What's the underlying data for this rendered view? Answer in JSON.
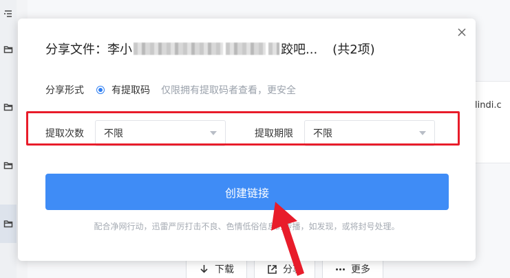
{
  "background": {
    "card_text": "lindi.c",
    "toolbar": {
      "download_label": "下载",
      "share_label": "分享",
      "more_label": "更多"
    }
  },
  "dialog": {
    "title_prefix": "分享文件：李小",
    "title_suffix": "跤吧...",
    "count": "(共2项)",
    "share_form_label": "分享形式",
    "option_label": "有提取码",
    "option_hint": "仅限拥有提取码者查看，更安全",
    "extract_count_label": "提取次数",
    "extract_count_value": "不限",
    "extract_period_label": "提取期限",
    "extract_period_value": "不限",
    "create_button_label": "创建链接",
    "notice": "配合净网行动，迅雷严厉打击不良、色情低俗信息的传播，如发现，或将封号处理。"
  },
  "colors": {
    "accent": "#3f8cf6",
    "highlight": "#e81c2a",
    "arrow": "#e81c2a"
  },
  "icons": [
    "close-icon",
    "folder-icon",
    "list-icon",
    "download-icon",
    "share-icon",
    "more-icon"
  ]
}
